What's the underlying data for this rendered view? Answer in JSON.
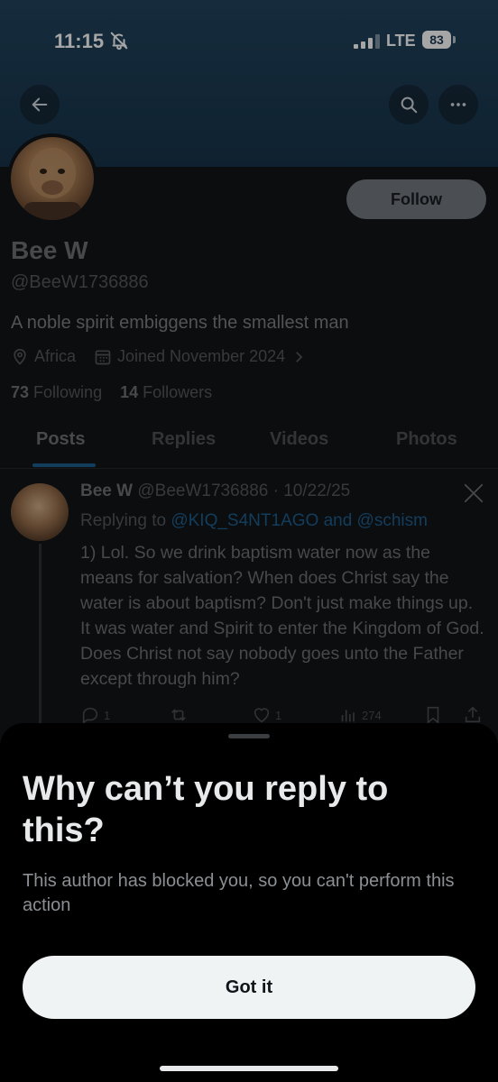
{
  "status_bar": {
    "time": "11:15",
    "network": "LTE",
    "battery": "83"
  },
  "profile": {
    "follow_label": "Follow",
    "display_name": "Bee W",
    "handle": "@BeeW1736886",
    "bio": "A noble spirit embiggens the smallest man",
    "location": "Africa",
    "joined": "Joined November 2024",
    "following_count": "73",
    "following_label": "Following",
    "followers_count": "14",
    "followers_label": "Followers"
  },
  "tabs": [
    "Posts",
    "Replies",
    "Videos",
    "Photos"
  ],
  "post": {
    "author_name": "Bee W",
    "author_handle_date": "@BeeW1736886 · 10/22/25",
    "replying_prefix": "Replying to",
    "replying_to": "@KIQ_S4NT1AGO and @schism",
    "text": "1) Lol. So we drink baptism water now as the means for salvation? When does Christ say the water is about baptism? Don't just make things up. It was water and Spirit to enter the Kingdom of God. Does Christ not say nobody goes unto the Father except through him?",
    "reply_count": "1",
    "like_count": "1",
    "view_count": "274"
  },
  "sheet": {
    "title": "Why can’t you reply to this?",
    "body": "This author has blocked you, so you can't perform this action",
    "button_label": "Got it"
  },
  "colors": {
    "banner": "#1b3a52",
    "accent": "#1d9bf0",
    "sheet_bg": "#000000",
    "button_bg": "#eff3f4"
  },
  "icons": [
    "bell-off-icon",
    "signal-icon",
    "battery-icon",
    "back-arrow-icon",
    "search-icon",
    "more-icon",
    "location-icon",
    "calendar-icon",
    "chevron-right-icon",
    "x-logo-icon",
    "reply-icon",
    "repost-icon",
    "like-icon",
    "views-icon",
    "bookmark-icon",
    "share-icon"
  ]
}
